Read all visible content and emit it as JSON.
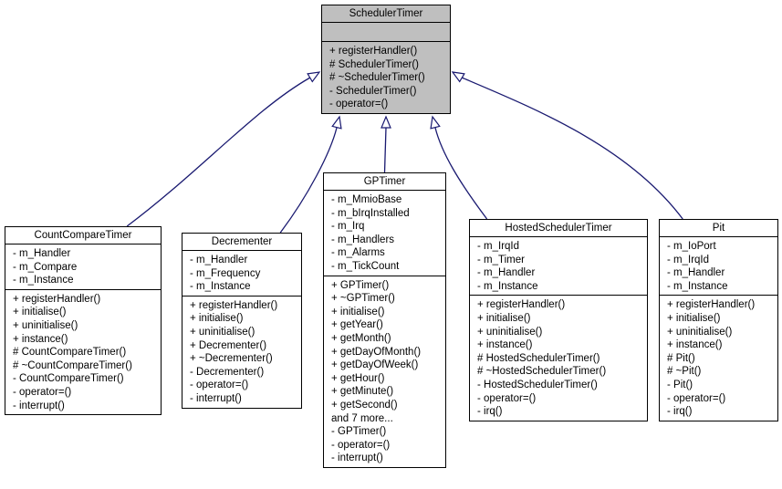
{
  "diagram": {
    "type": "class-inheritance",
    "base": {
      "name": "SchedulerTimer",
      "attributes": [],
      "methods": [
        "+ registerHandler()",
        "# SchedulerTimer()",
        "# ~SchedulerTimer()",
        "- SchedulerTimer()",
        "- operator=()"
      ]
    },
    "derived": [
      {
        "name": "CountCompareTimer",
        "attributes": [
          "- m_Handler",
          "- m_Compare",
          "- m_Instance"
        ],
        "methods": [
          "+ registerHandler()",
          "+ initialise()",
          "+ uninitialise()",
          "+ instance()",
          "# CountCompareTimer()",
          "# ~CountCompareTimer()",
          "- CountCompareTimer()",
          "- operator=()",
          "- interrupt()"
        ]
      },
      {
        "name": "Decrementer",
        "attributes": [
          "- m_Handler",
          "- m_Frequency",
          "- m_Instance"
        ],
        "methods": [
          "+ registerHandler()",
          "+ initialise()",
          "+ uninitialise()",
          "+ Decrementer()",
          "+ ~Decrementer()",
          "- Decrementer()",
          "- operator=()",
          "- interrupt()"
        ]
      },
      {
        "name": "GPTimer",
        "attributes": [
          "- m_MmioBase",
          "- m_bIrqInstalled",
          "- m_Irq",
          "- m_Handlers",
          "- m_Alarms",
          "- m_TickCount"
        ],
        "methods": [
          "+ GPTimer()",
          "+ ~GPTimer()",
          "+ initialise()",
          "+ getYear()",
          "+ getMonth()",
          "+ getDayOfMonth()",
          "+ getDayOfWeek()",
          "+ getHour()",
          "+ getMinute()",
          "+ getSecond()",
          "and 7 more...",
          "- GPTimer()",
          "- operator=()",
          "- interrupt()"
        ]
      },
      {
        "name": "HostedSchedulerTimer",
        "attributes": [
          "- m_IrqId",
          "- m_Timer",
          "- m_Handler",
          "- m_Instance"
        ],
        "methods": [
          "+ registerHandler()",
          "+ initialise()",
          "+ uninitialise()",
          "+ instance()",
          "# HostedSchedulerTimer()",
          "# ~HostedSchedulerTimer()",
          "- HostedSchedulerTimer()",
          "- operator=()",
          "- irq()"
        ]
      },
      {
        "name": "Pit",
        "attributes": [
          "- m_IoPort",
          "- m_IrqId",
          "- m_Handler",
          "- m_Instance"
        ],
        "methods": [
          "+ registerHandler()",
          "+ initialise()",
          "+ uninitialise()",
          "+ instance()",
          "# Pit()",
          "# ~Pit()",
          "- Pit()",
          "- operator=()",
          "- irq()"
        ]
      }
    ],
    "colors": {
      "base_fill": "#bfbfbf",
      "box_fill": "#ffffff",
      "edge": "#191970"
    }
  }
}
